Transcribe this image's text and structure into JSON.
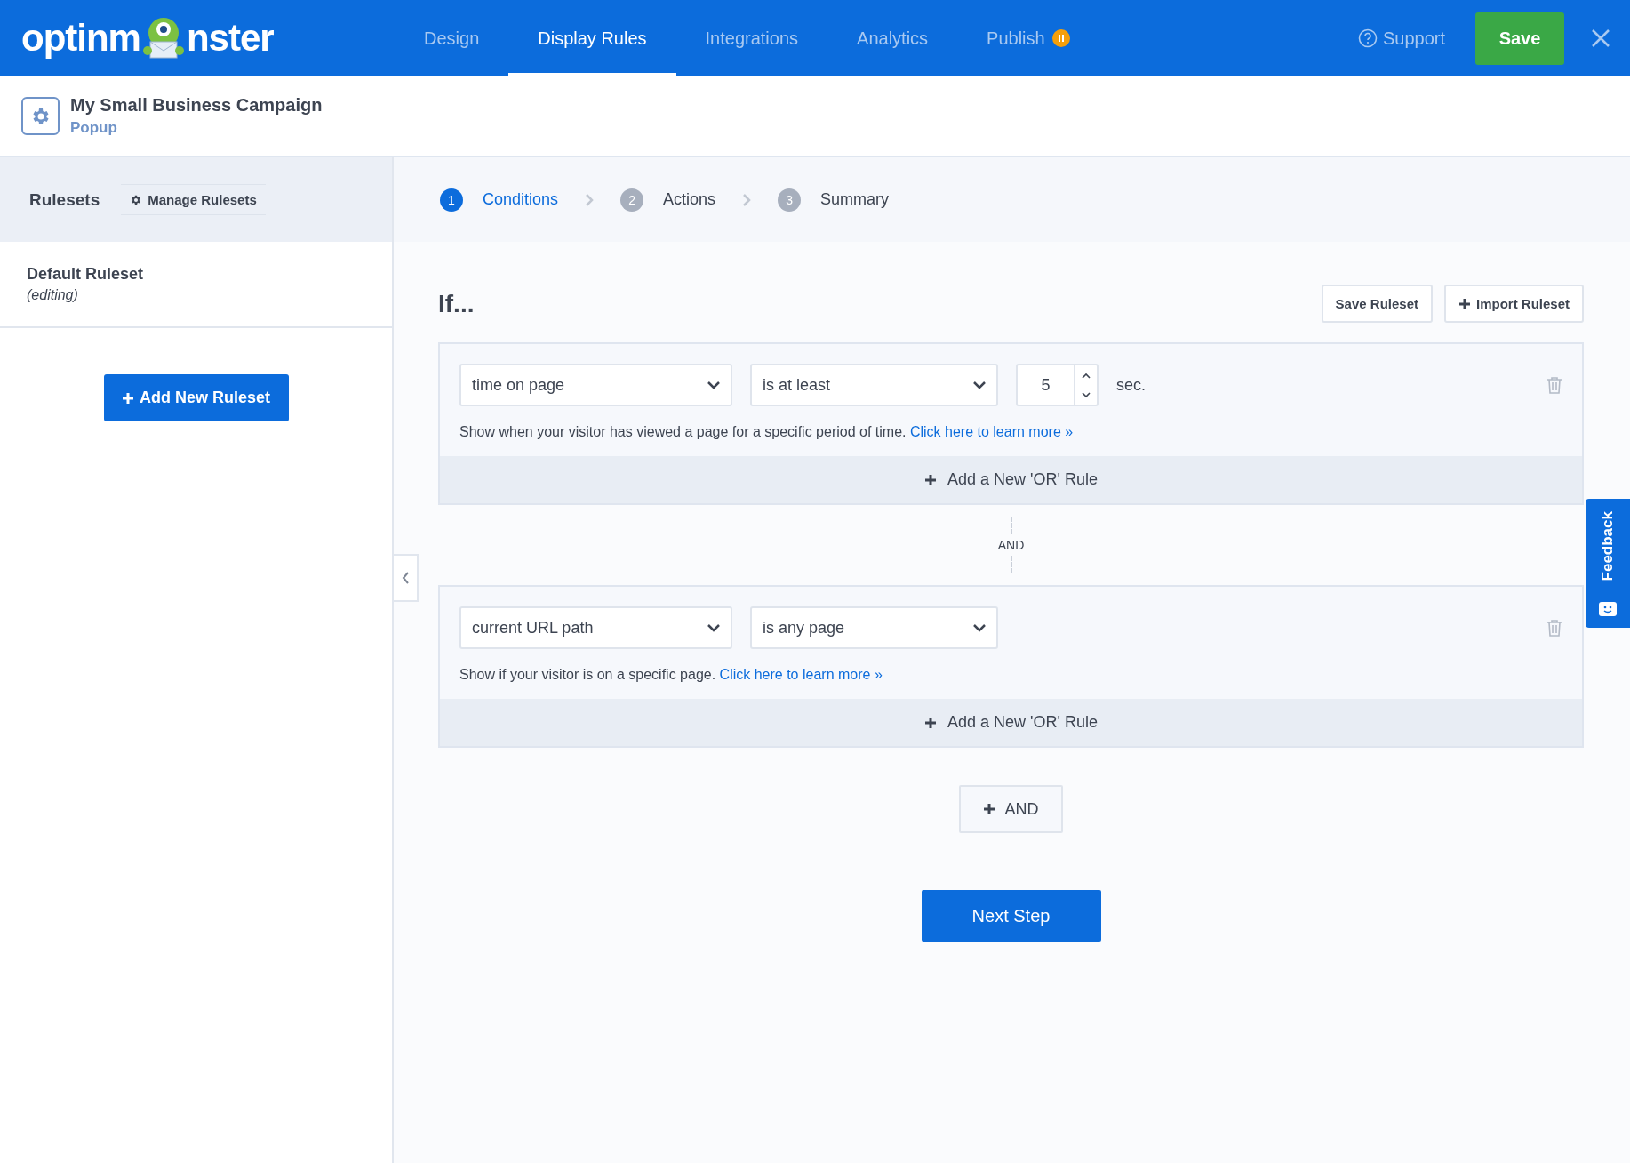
{
  "logo": {
    "before": "optinm",
    "after": "nster"
  },
  "nav": [
    {
      "label": "Design",
      "selected": false
    },
    {
      "label": "Display Rules",
      "selected": true
    },
    {
      "label": "Integrations",
      "selected": false
    },
    {
      "label": "Analytics",
      "selected": false
    },
    {
      "label": "Publish",
      "selected": false,
      "paused": true
    }
  ],
  "support": "Support",
  "save": "Save",
  "campaign": {
    "title": "My Small Business Campaign",
    "type": "Popup"
  },
  "sidebar": {
    "title": "Rulesets",
    "manage": "Manage Rulesets",
    "rulesets": [
      {
        "name": "Default Ruleset",
        "note": "(editing)"
      }
    ],
    "add_button": "Add New Ruleset"
  },
  "steps": [
    {
      "number": "1",
      "label": "Conditions",
      "selected": true
    },
    {
      "number": "2",
      "label": "Actions",
      "selected": false
    },
    {
      "number": "3",
      "label": "Summary",
      "selected": false
    }
  ],
  "heading": "If...",
  "save_ruleset": "Save Ruleset",
  "import_ruleset": "Import Ruleset",
  "rules": [
    {
      "field": "time on page",
      "operator": "is at least",
      "value": "5",
      "unit": "sec.",
      "description": "Show when your visitor has viewed a page for a specific period of time.",
      "link": "Click here to learn more »",
      "or_button": "Add a New 'OR' Rule"
    },
    {
      "field": "current URL path",
      "operator": "is any page",
      "description": "Show if your visitor is on a specific page.",
      "link": "Click here to learn more »",
      "or_button": "Add a New 'OR' Rule"
    }
  ],
  "connector": "AND",
  "and_button": "AND",
  "next_button": "Next Step",
  "feedback": "Feedback"
}
